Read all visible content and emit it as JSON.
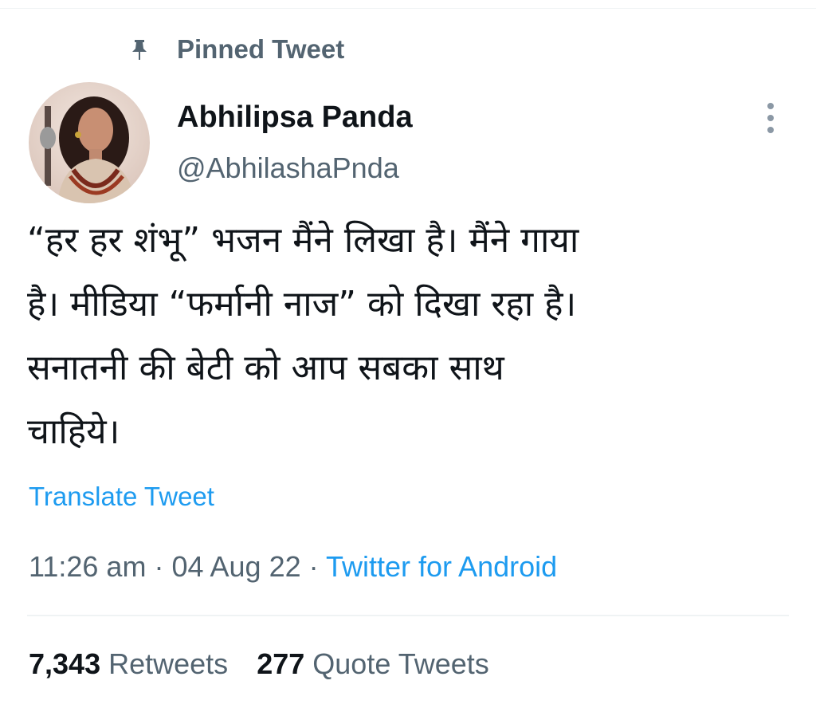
{
  "pinned": {
    "label": "Pinned Tweet",
    "icon": "pin-icon"
  },
  "author": {
    "name": "Abhilipsa Panda",
    "handle": "@AbhilashaPnda",
    "avatar_icon": "avatar"
  },
  "more_icon": "more-vertical-icon",
  "tweet": {
    "lines": [
      "“हर हर शंभू” भजन मैंने लिखा है। मैंने गाया",
      "है। मीडिया “फर्मानी नाज” को दिखा रहा है।",
      "सनातनी की बेटी को आप सबका साथ",
      "चाहिये।"
    ]
  },
  "translate_label": "Translate Tweet",
  "meta": {
    "time": "11:26 am",
    "separator": "·",
    "date": "04 Aug 22",
    "source": "Twitter for Android"
  },
  "stats": {
    "retweets_count": "7,343",
    "retweets_label": "Retweets",
    "quotes_count": "277",
    "quotes_label": "Quote Tweets"
  },
  "colors": {
    "link": "#1d9bf0",
    "secondary_text": "#536471",
    "primary_text": "#0f1419",
    "divider": "#eff3f4"
  }
}
